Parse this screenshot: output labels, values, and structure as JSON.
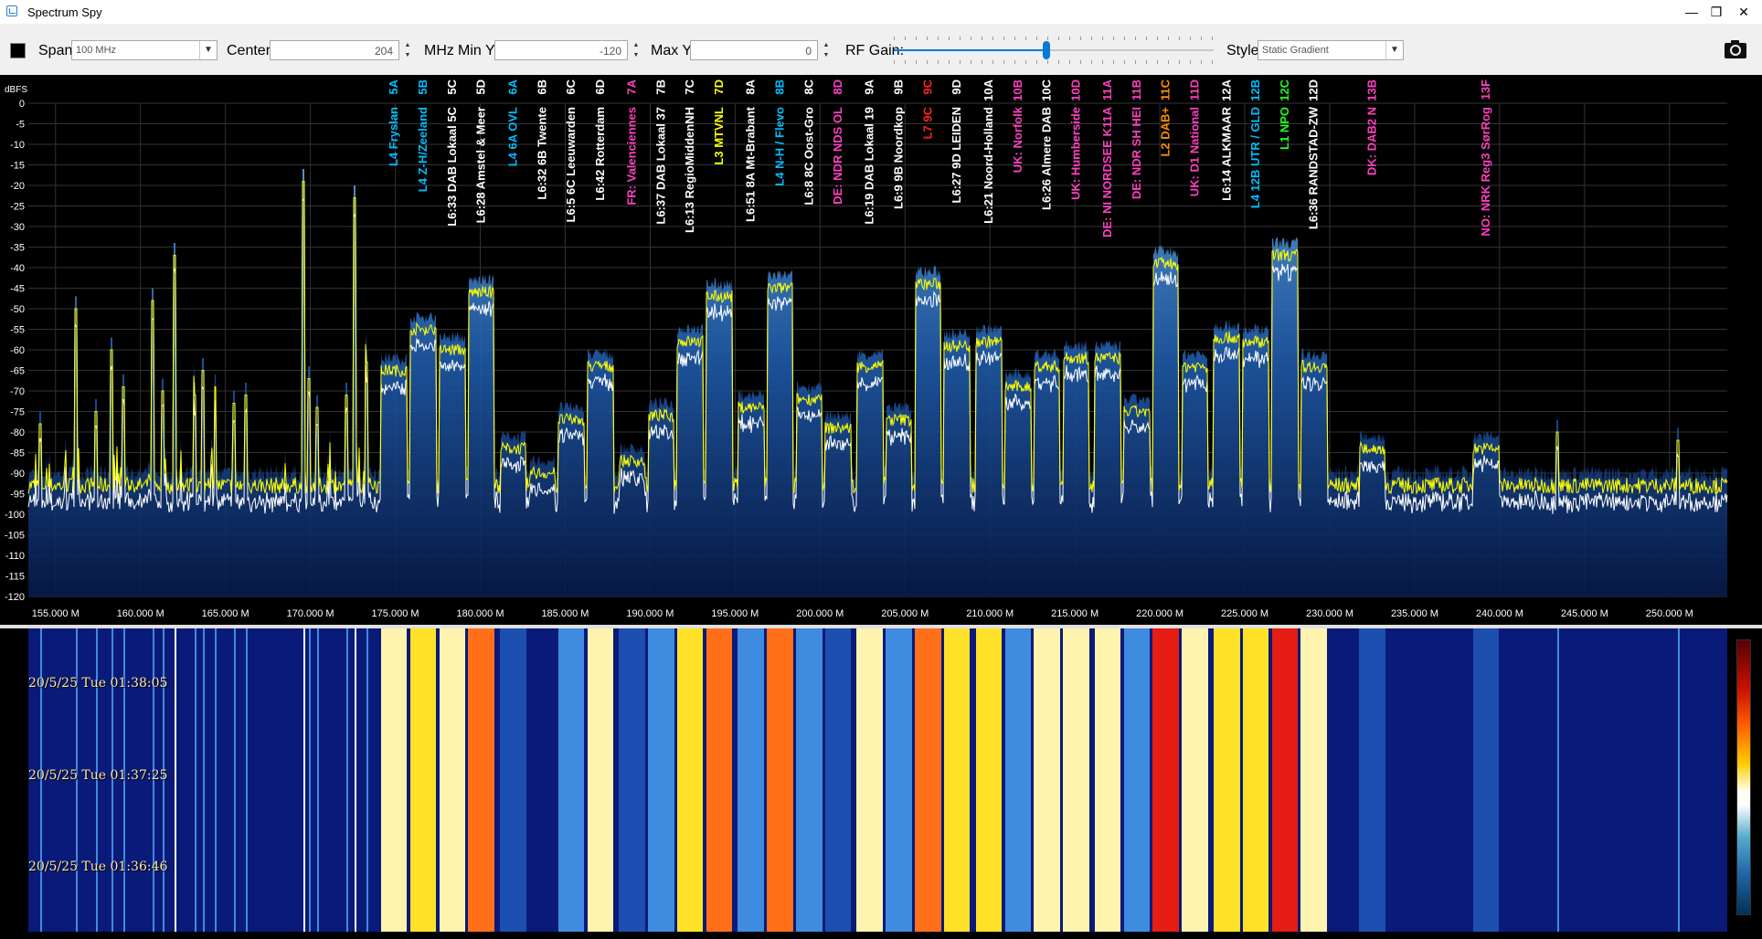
{
  "window": {
    "title": "Spectrum Spy",
    "minimize": "—",
    "maximize": "❐",
    "close": "✕"
  },
  "toolbar": {
    "span_label": "Span:",
    "span_value": "100 MHz",
    "center_label": "Center:",
    "center_value": "204",
    "center_unit": "MHz",
    "miny_label": "Min Y:",
    "miny_value": "-120",
    "maxy_label": "Max Y:",
    "maxy_value": "0",
    "rfgain_label": "RF Gain:",
    "style_label": "Style:",
    "style_value": "Static Gradient",
    "icons": {
      "color_swatch": "color-swatch-icon",
      "camera": "camera-icon"
    }
  },
  "chart_data": {
    "type": "line",
    "ylabel": "dBFS",
    "ylim": [
      -120,
      0
    ],
    "xlim": [
      153.4,
      253.4
    ],
    "y_ticks": [
      0,
      -5,
      -10,
      -15,
      -20,
      -25,
      -30,
      -35,
      -40,
      -45,
      -50,
      -55,
      -60,
      -65,
      -70,
      -75,
      -80,
      -85,
      -90,
      -95,
      -100,
      -105,
      -110,
      -115,
      -120
    ],
    "x_ticks": [
      155,
      160,
      165,
      170,
      175,
      180,
      185,
      190,
      195,
      200,
      205,
      210,
      215,
      220,
      225,
      230,
      235,
      240,
      245,
      250
    ],
    "x_tick_labels": [
      "155.000 M",
      "160.000 M",
      "165.000 M",
      "170.000 M",
      "175.000 M",
      "180.000 M",
      "185.000 M",
      "190.000 M",
      "195.000 M",
      "200.000 M",
      "205.000 M",
      "210.000 M",
      "215.000 M",
      "220.000 M",
      "225.000 M",
      "230.000 M",
      "235.000 M",
      "240.000 M",
      "245.000 M",
      "250.000 M"
    ],
    "series": [
      {
        "kind": "peak",
        "color": "#ffff00"
      },
      {
        "kind": "average",
        "color": "#ffffff"
      }
    ],
    "noise_floor": -93,
    "blocks": [
      {
        "f": 174.928,
        "level": -65
      },
      {
        "f": 176.64,
        "level": -55
      },
      {
        "f": 178.352,
        "level": -60
      },
      {
        "f": 180.064,
        "level": -46
      },
      {
        "f": 181.936,
        "level": -84
      },
      {
        "f": 183.648,
        "level": -90
      },
      {
        "f": 185.36,
        "level": -77
      },
      {
        "f": 187.072,
        "level": -64
      },
      {
        "f": 188.928,
        "level": -87
      },
      {
        "f": 190.64,
        "level": -76
      },
      {
        "f": 192.352,
        "level": -58
      },
      {
        "f": 194.064,
        "level": -47
      },
      {
        "f": 195.936,
        "level": -74
      },
      {
        "f": 197.648,
        "level": -45
      },
      {
        "f": 199.36,
        "level": -72
      },
      {
        "f": 201.072,
        "level": -79
      },
      {
        "f": 202.928,
        "level": -64
      },
      {
        "f": 204.64,
        "level": -77
      },
      {
        "f": 206.352,
        "level": -44
      },
      {
        "f": 208.064,
        "level": -59
      },
      {
        "f": 209.936,
        "level": -58
      },
      {
        "f": 211.648,
        "level": -69
      },
      {
        "f": 213.36,
        "level": -64
      },
      {
        "f": 215.072,
        "level": -62
      },
      {
        "f": 216.928,
        "level": -62
      },
      {
        "f": 218.64,
        "level": -75
      },
      {
        "f": 220.352,
        "level": -39
      },
      {
        "f": 222.064,
        "level": -64
      },
      {
        "f": 223.936,
        "level": -57
      },
      {
        "f": 225.648,
        "level": -58
      },
      {
        "f": 227.36,
        "level": -37
      },
      {
        "f": 229.072,
        "level": -64
      },
      {
        "f": 232.496,
        "level": -84
      },
      {
        "f": 239.2,
        "level": -84
      }
    ],
    "spikes": [
      {
        "f": 154.1,
        "level": -78
      },
      {
        "f": 156.2,
        "level": -50
      },
      {
        "f": 157.4,
        "level": -75
      },
      {
        "f": 158.3,
        "level": -60
      },
      {
        "f": 159.0,
        "level": -69
      },
      {
        "f": 160.7,
        "level": -48
      },
      {
        "f": 161.3,
        "level": -70
      },
      {
        "f": 162.0,
        "level": -37
      },
      {
        "f": 163.2,
        "level": -71
      },
      {
        "f": 163.7,
        "level": -65
      },
      {
        "f": 164.4,
        "level": -69
      },
      {
        "f": 165.5,
        "level": -73
      },
      {
        "f": 166.2,
        "level": -71
      },
      {
        "f": 169.6,
        "level": -19
      },
      {
        "f": 169.9,
        "level": -67
      },
      {
        "f": 170.4,
        "level": -74
      },
      {
        "f": 172.1,
        "level": -71
      },
      {
        "f": 172.6,
        "level": -23
      },
      {
        "f": 173.3,
        "level": -63
      },
      {
        "f": 243.4,
        "level": -80
      },
      {
        "f": 250.5,
        "level": -82
      }
    ],
    "channel_labels": [
      {
        "f": 174.928,
        "text": "L4 Fryslan",
        "ch": "5A",
        "color": "#00bfff",
        "ch_color": "#00bfff"
      },
      {
        "f": 176.64,
        "text": "L4 Z-H/Zeeland",
        "ch": "5B",
        "color": "#00bfff",
        "ch_color": "#00bfff"
      },
      {
        "f": 178.352,
        "text": "L6:33 DAB Lokaal 5C",
        "ch": "5C",
        "color": "#ffffff",
        "ch_color": "#ffffff"
      },
      {
        "f": 180.064,
        "text": "L6:28 Amstel & Meer",
        "ch": "5D",
        "color": "#ffffff",
        "ch_color": "#ffffff"
      },
      {
        "f": 181.936,
        "text": "L4 6A OVL",
        "ch": "6A",
        "color": "#00bfff",
        "ch_color": "#00bfff"
      },
      {
        "f": 183.648,
        "text": "L6:32 6B Twente",
        "ch": "6B",
        "color": "#ffffff",
        "ch_color": "#ffffff"
      },
      {
        "f": 185.36,
        "text": "L6:5 6C Leeuwarden",
        "ch": "6C",
        "color": "#ffffff",
        "ch_color": "#ffffff"
      },
      {
        "f": 187.072,
        "text": "L6:42 Rotterdam",
        "ch": "6D",
        "color": "#ffffff",
        "ch_color": "#ffffff"
      },
      {
        "f": 188.928,
        "text": "FR: Valenciennes",
        "ch": "7A",
        "color": "#ff40c0",
        "ch_color": "#ff40c0"
      },
      {
        "f": 190.64,
        "text": "L6:37 DAB Lokaal 37",
        "ch": "7B",
        "color": "#ffffff",
        "ch_color": "#ffffff"
      },
      {
        "f": 192.352,
        "text": "L6:13 RegioMiddenNH",
        "ch": "7C",
        "color": "#ffffff",
        "ch_color": "#ffffff"
      },
      {
        "f": 194.064,
        "text": "L3 MTVNL",
        "ch": "7D",
        "color": "#ffff00",
        "ch_color": "#ffff00"
      },
      {
        "f": 195.936,
        "text": "L6:51 8A Mt-Brabant",
        "ch": "8A",
        "color": "#ffffff",
        "ch_color": "#ffffff"
      },
      {
        "f": 197.648,
        "text": "L4 N-H / Flevo",
        "ch": "8B",
        "color": "#00bfff",
        "ch_color": "#00bfff"
      },
      {
        "f": 199.36,
        "text": "L6:8 8C Oost-Gro",
        "ch": "8C",
        "color": "#ffffff",
        "ch_color": "#ffffff"
      },
      {
        "f": 201.072,
        "text": "DE: NDR NDS OL",
        "ch": "8D",
        "color": "#ff40c0",
        "ch_color": "#ff40c0"
      },
      {
        "f": 202.928,
        "text": "L6:19 DAB Lokaal 19",
        "ch": "9A",
        "color": "#ffffff",
        "ch_color": "#ffffff"
      },
      {
        "f": 204.64,
        "text": "L6:9 9B Noordkop",
        "ch": "9B",
        "color": "#ffffff",
        "ch_color": "#ffffff"
      },
      {
        "f": 206.352,
        "text": "L7 9C",
        "ch": "9C",
        "color": "#ff2020",
        "ch_color": "#ff2020"
      },
      {
        "f": 208.064,
        "text": "L6:27 9D LEIDEN",
        "ch": "9D",
        "color": "#ffffff",
        "ch_color": "#ffffff"
      },
      {
        "f": 209.936,
        "text": "L6:21 Noord-Holland",
        "ch": "10A",
        "color": "#ffffff",
        "ch_color": "#ffffff"
      },
      {
        "f": 211.648,
        "text": "UK: Norfolk",
        "ch": "10B",
        "color": "#ff40c0",
        "ch_color": "#ff40c0"
      },
      {
        "f": 213.36,
        "text": "L6:26 Almere DAB",
        "ch": "10C",
        "color": "#ffffff",
        "ch_color": "#ffffff"
      },
      {
        "f": 215.072,
        "text": "UK: Humberside",
        "ch": "10D",
        "color": "#ff40c0",
        "ch_color": "#ff40c0"
      },
      {
        "f": 216.928,
        "text": "DE: NI NORDSEE K11A",
        "ch": "11A",
        "color": "#ff40c0",
        "ch_color": "#ff40c0"
      },
      {
        "f": 218.64,
        "text": "DE: NDR SH HEI",
        "ch": "11B",
        "color": "#ff40c0",
        "ch_color": "#ff40c0"
      },
      {
        "f": 220.352,
        "text": "L2 DAB+",
        "ch": "11C",
        "color": "#ff9000",
        "ch_color": "#ff9000"
      },
      {
        "f": 222.064,
        "text": "UK: D1 National",
        "ch": "11D",
        "color": "#ff40c0",
        "ch_color": "#ff40c0"
      },
      {
        "f": 223.936,
        "text": "L6:14 ALKMAAR",
        "ch": "12A",
        "color": "#ffffff",
        "ch_color": "#ffffff"
      },
      {
        "f": 225.648,
        "text": "L4 12B UTR / GLD",
        "ch": "12B",
        "color": "#00bfff",
        "ch_color": "#00bfff"
      },
      {
        "f": 227.36,
        "text": "L1 NPO",
        "ch": "12C",
        "color": "#20ff20",
        "ch_color": "#20ff20"
      },
      {
        "f": 229.072,
        "text": "L6:36 RANDSTAD-ZW",
        "ch": "12D",
        "color": "#ffffff",
        "ch_color": "#ffffff"
      },
      {
        "f": 232.496,
        "text": "DK: DAB2 N",
        "ch": "13B",
        "color": "#ff40c0",
        "ch_color": "#ff40c0"
      },
      {
        "f": 239.2,
        "text": "NO: NRK Reg3 SørRog",
        "ch": "13F",
        "color": "#ff40c0",
        "ch_color": "#ff40c0"
      }
    ]
  },
  "waterfall": {
    "timestamps": [
      "20/5/25 Tue 01:38:05",
      "20/5/25 Tue 01:37:25",
      "20/5/25 Tue 01:36:46"
    ],
    "colors": {
      "floor": "#0a1a78",
      "low": "#1c4fb0",
      "mid": "#3f8be0",
      "pale": "#fff3b0",
      "yellow": "#ffe228",
      "orange": "#ff7018",
      "red": "#e51d12"
    }
  }
}
